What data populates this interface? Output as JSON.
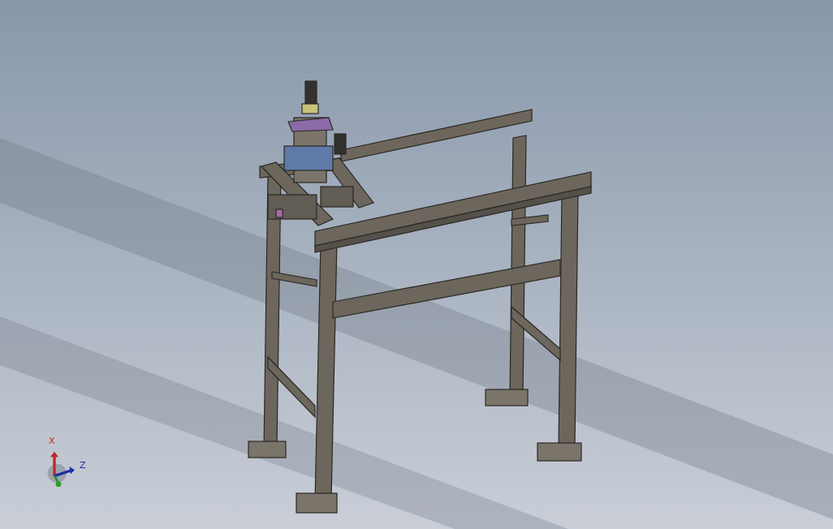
{
  "view_triad": {
    "x_label": "X",
    "z_label": "Z"
  }
}
